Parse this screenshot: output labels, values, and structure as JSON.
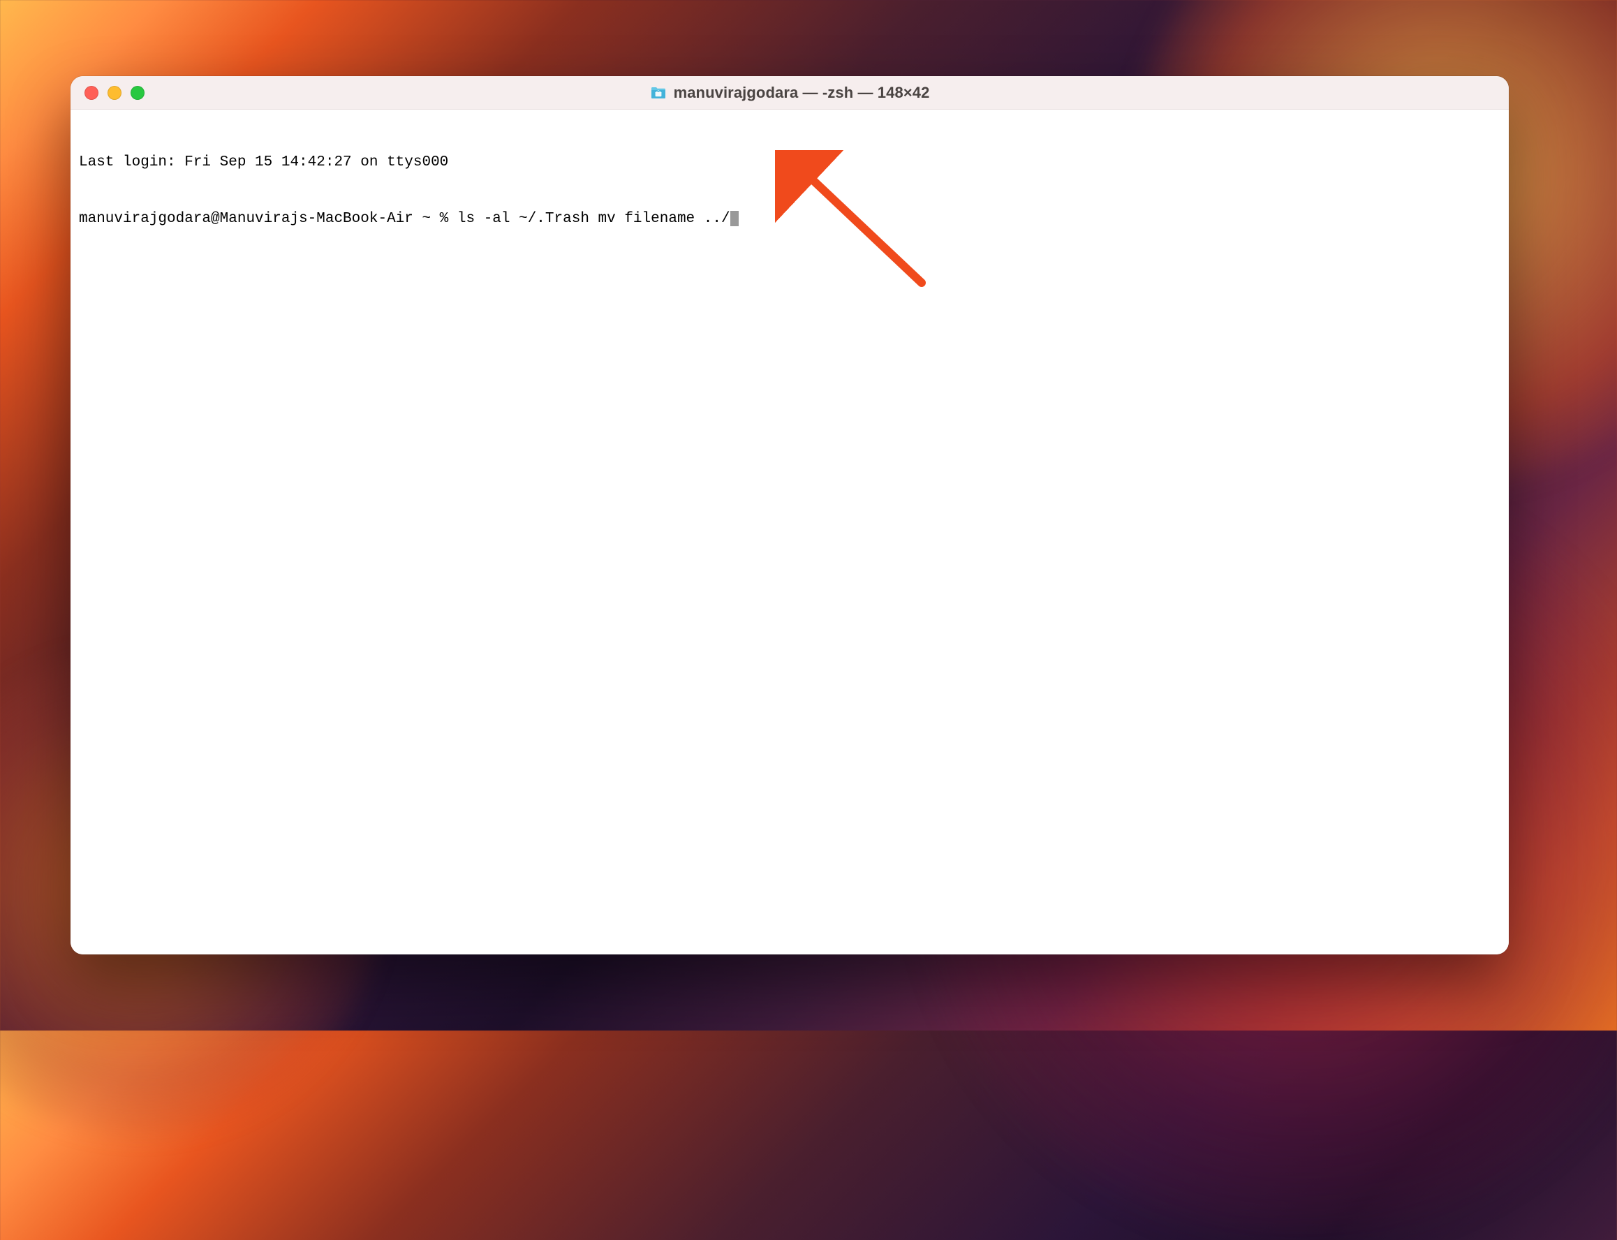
{
  "window": {
    "title": "manuvirajgodara — -zsh — 148×42",
    "traffic_lights": {
      "close": "close",
      "minimize": "minimize",
      "maximize": "maximize"
    },
    "folder_icon": "home-folder-icon"
  },
  "terminal": {
    "last_login_line": "Last login: Fri Sep 15 14:42:27 on ttys000",
    "prompt": "manuvirajgodara@Manuvirajs-MacBook-Air ~ % ",
    "command": "ls -al ~/.Trash mv filename ../"
  },
  "annotation": {
    "type": "arrow",
    "color": "#F04A1C"
  }
}
